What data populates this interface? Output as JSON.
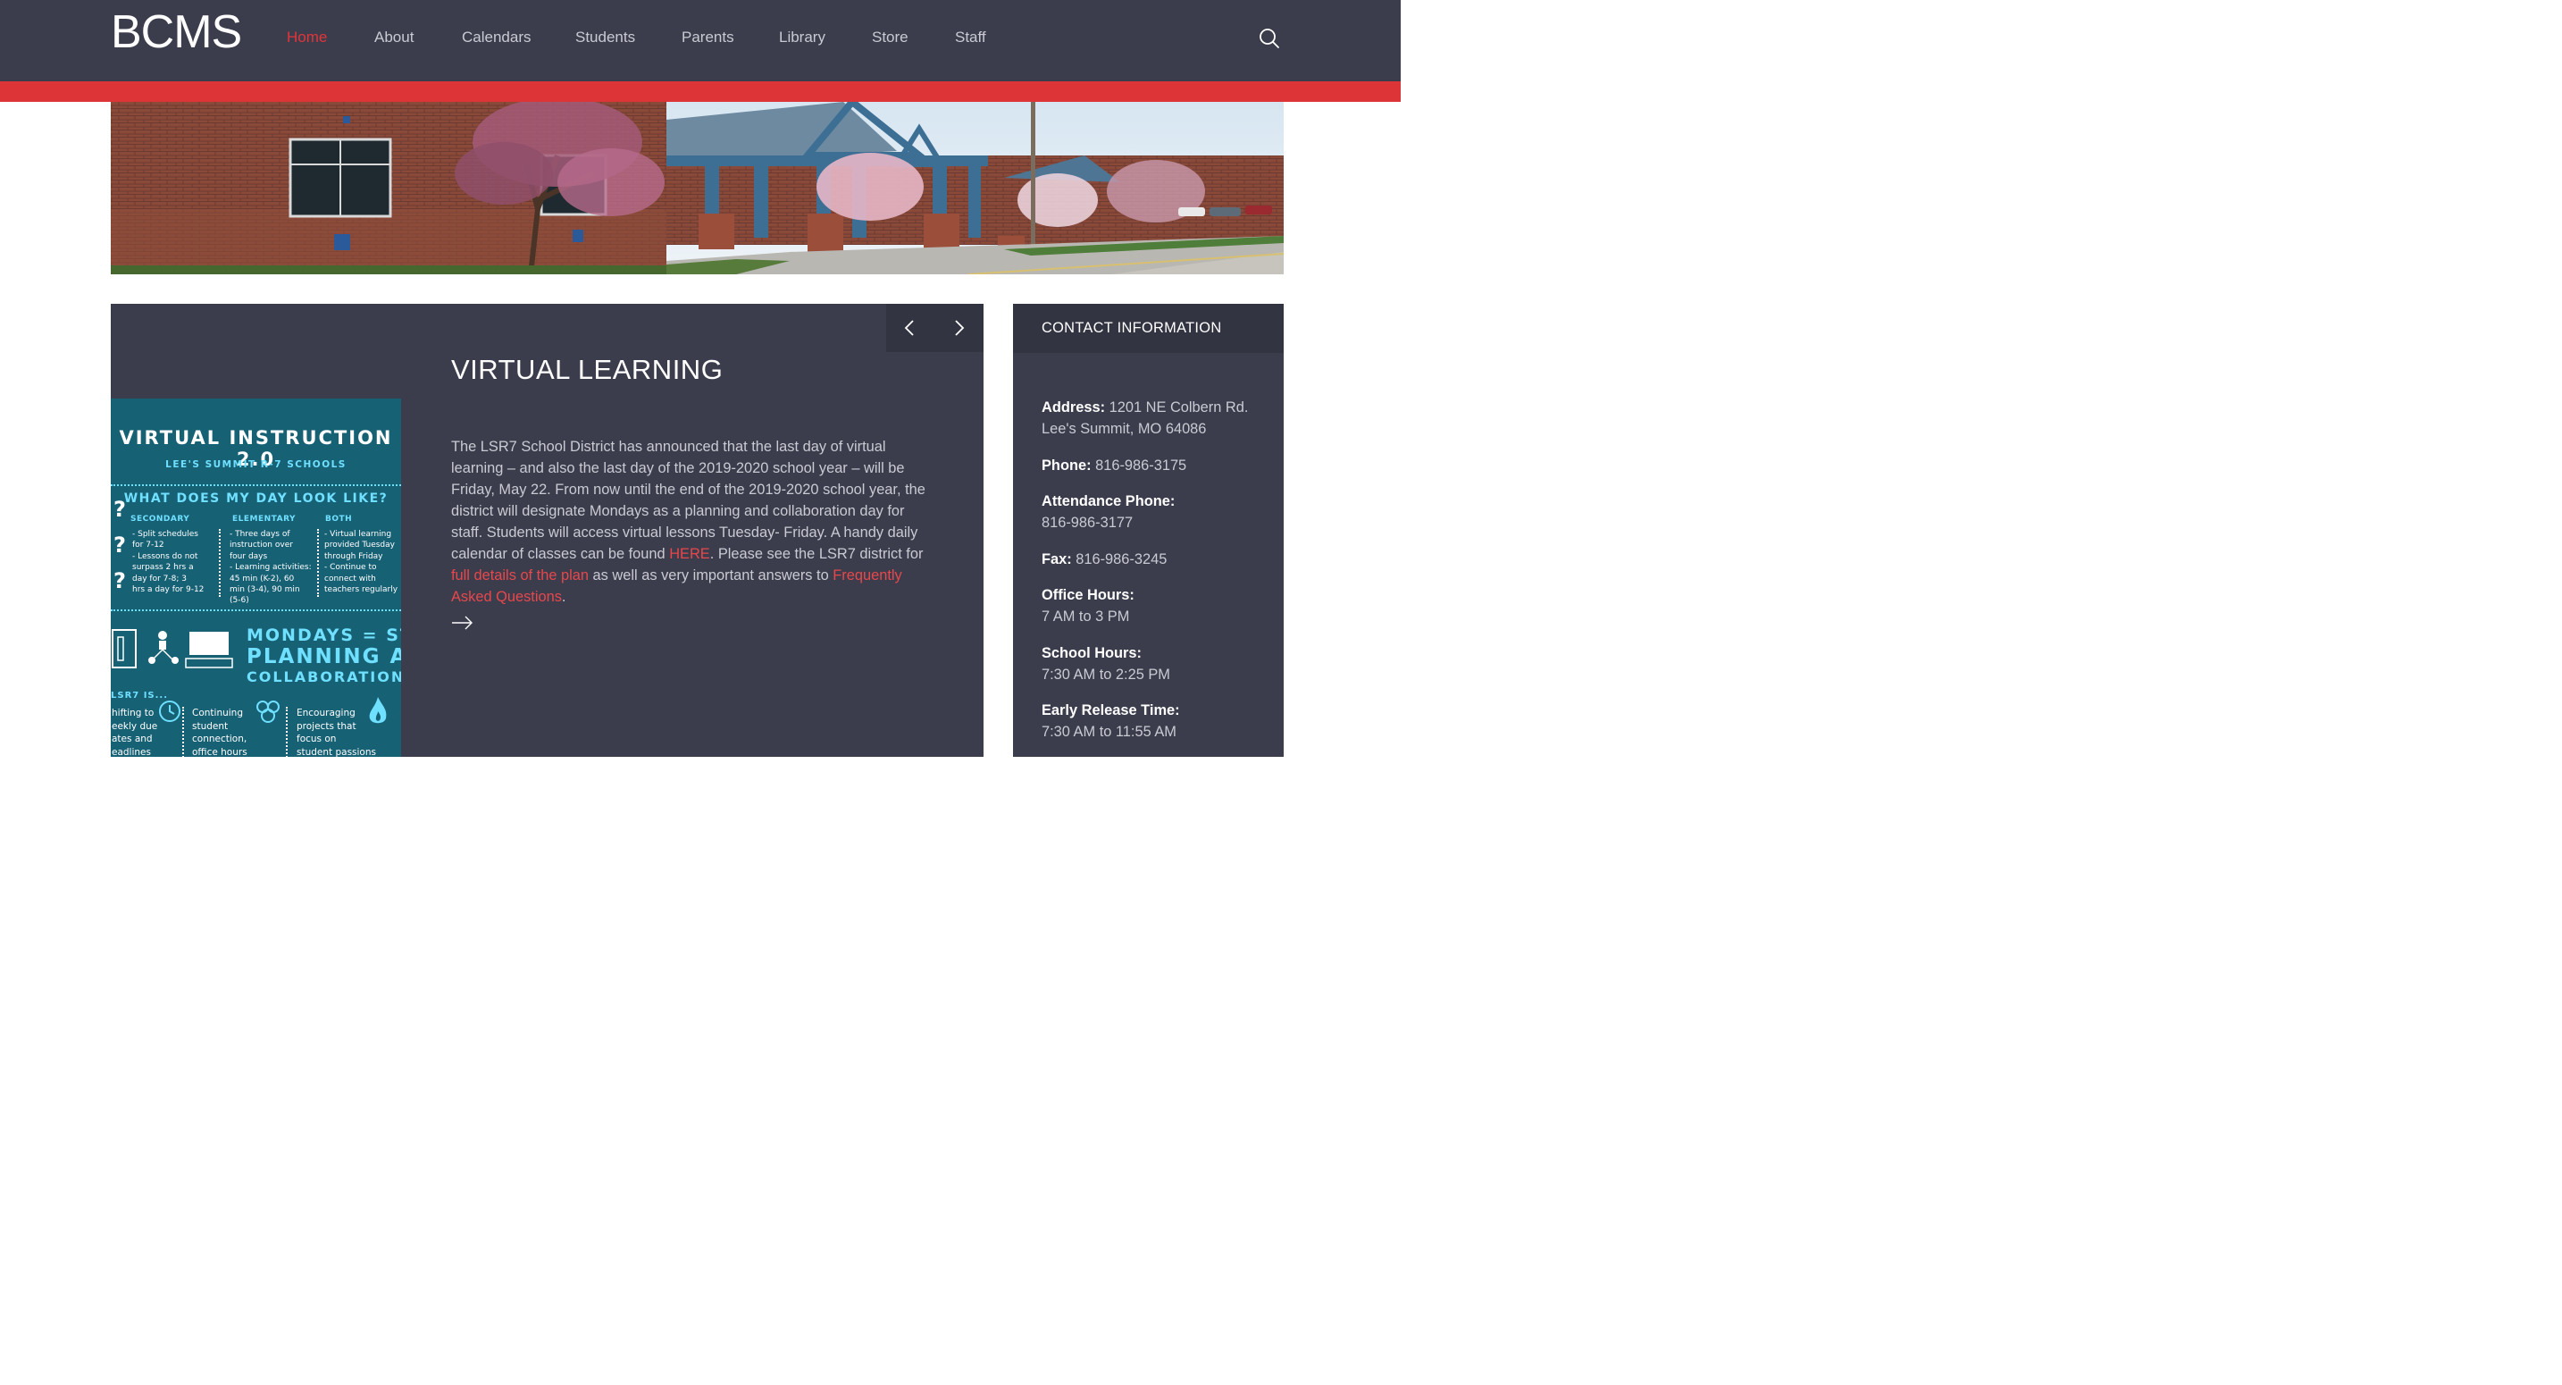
{
  "header": {
    "logo": "BCMS",
    "nav": [
      {
        "label": "Home",
        "active": true
      },
      {
        "label": "About",
        "active": false
      },
      {
        "label": "Calendars",
        "active": false
      },
      {
        "label": "Students",
        "active": false
      },
      {
        "label": "Parents",
        "active": false
      },
      {
        "label": "Library",
        "active": false
      },
      {
        "label": "Store",
        "active": false
      },
      {
        "label": "Staff",
        "active": false
      }
    ],
    "search_icon": "search-icon"
  },
  "colors": {
    "header_bg": "#3b3d4d",
    "accent_red": "#dd3437",
    "link_red": "#e8474b",
    "panel_bg": "#3b3d4d",
    "panel_head_bg": "#323442",
    "text_muted": "#c9cad2",
    "flyer_bg": "#176175",
    "flyer_cyan": "#6fe0ff"
  },
  "post": {
    "title": "VIRTUAL LEARNING",
    "body_part1": "The LSR7 School District has announced that the last day of virtual learning – and also the last day of the 2019-2020 school year – will be Friday, May 22. From now until the end of the 2019-2020 school year, the district will designate Mondays as a planning and collaboration day for staff. Students will access virtual lessons Tuesday- Friday. A handy daily calendar of classes can be found ",
    "link_here": "HERE",
    "body_part2": ". Please see the LSR7 district for ",
    "link_details": "full details of the plan",
    "body_part3": " as well as very important answers to ",
    "link_faq": "Frequently Asked Questions",
    "body_part4": ".",
    "prev_icon": "chevron-left-icon",
    "next_icon": "chevron-right-icon",
    "more_icon": "arrow-right-icon"
  },
  "flyer": {
    "title": "VIRTUAL INSTRUCTION 2.0",
    "subtitle": "LEE'S SUMMIT R-7 SCHOOLS",
    "question": "WHAT DOES MY DAY LOOK LIKE?",
    "col1_head": "SECONDARY",
    "col1_text": "- Split schedules\nfor 7-12\n- Lessons do not\nsurpass 2 hrs a\nday for 7-8; 3\nhrs a day for 9-12",
    "col2_head": "ELEMENTARY",
    "col2_text": "- Three days of\ninstruction over\nfour days\n- Learning activities:\n45 min (K-2), 60\nmin (3-4), 90 min\n(5-6)",
    "col3_head": "BOTH",
    "col3_text": "- Virtual learning\nprovided Tuesday\nthrough Friday\n- Continue to\nconnect with\nteachers regularly",
    "mondays_1": "MONDAYS = STAFF",
    "mondays_2": "PLANNING AND",
    "mondays_3": "COLLABORATION DAY",
    "lsr7_is": "LSR7 IS...",
    "b1": "hifting to\neekly due\nates and\neadlines",
    "b2": "Continuing\nstudent\nconnection,\noffice hours",
    "b3": "Encouraging\nprojects that\nfocus on\nstudent passions"
  },
  "contact": {
    "title": "CONTACT INFORMATION",
    "address_label": "Address:",
    "address_value": " 1201 NE Colbern Rd. Lee's Summit, MO 64086",
    "phone_label": "Phone:",
    "phone_value": " 816-986-3175",
    "attendance_label": "Attendance Phone:",
    "attendance_value": "816-986-3177",
    "fax_label": "Fax:",
    "fax_value": " 816-986-3245",
    "office_label": "Office Hours:",
    "office_value": "7 AM to 3 PM",
    "school_label": "School Hours:",
    "school_value": "7:30 AM to 2:25 PM",
    "early_label": "Early Release Time:",
    "early_value": "7:30 AM to 11:55 AM"
  }
}
